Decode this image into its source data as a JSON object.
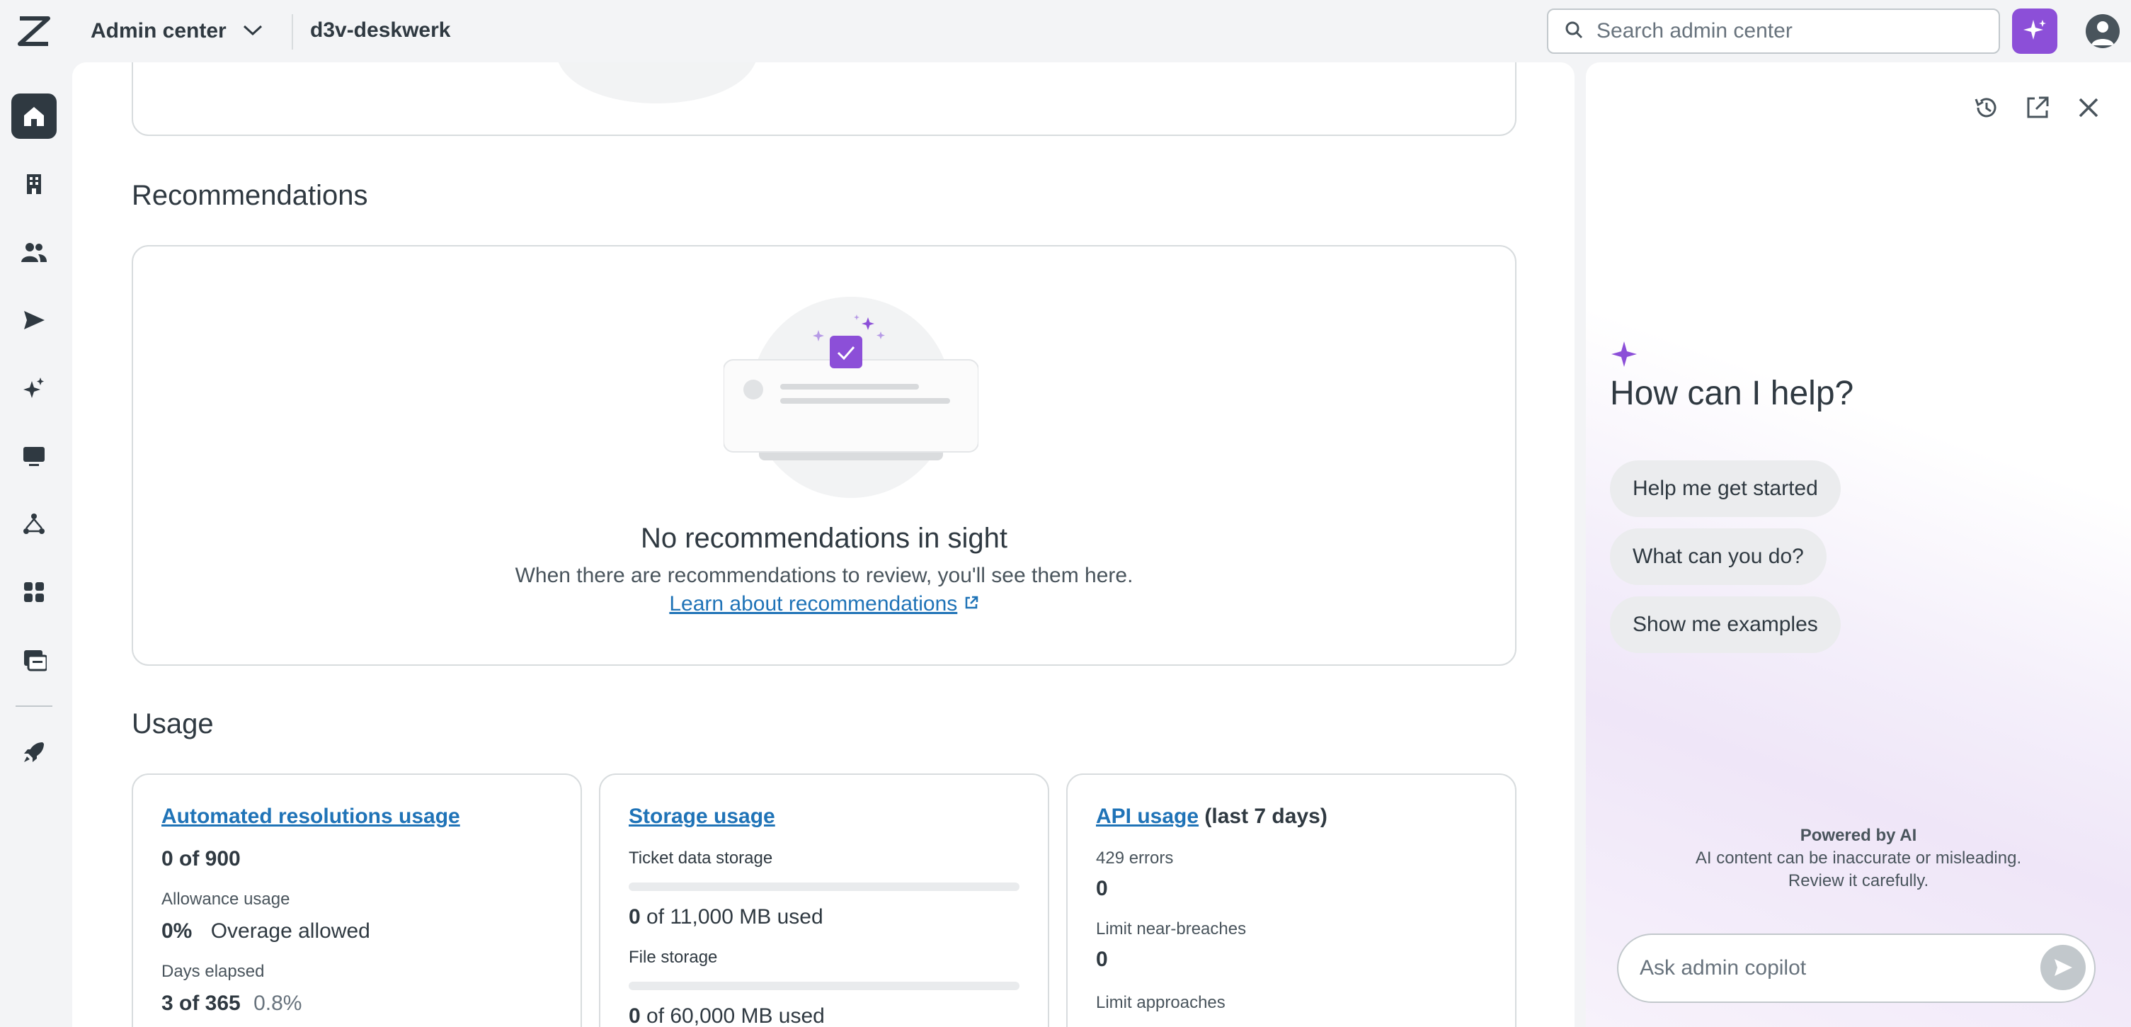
{
  "topbar": {
    "product_name": "Admin center",
    "account_name": "d3v-deskwerk",
    "search_placeholder": "Search admin center"
  },
  "sidebar": {
    "items": [
      {
        "name": "home",
        "active": true
      },
      {
        "name": "account"
      },
      {
        "name": "people"
      },
      {
        "name": "channels"
      },
      {
        "name": "ai"
      },
      {
        "name": "workspaces"
      },
      {
        "name": "objects-and-rules"
      },
      {
        "name": "apps-and-integrations"
      },
      {
        "name": "marketplace"
      },
      {
        "name": "get-started"
      }
    ]
  },
  "main": {
    "recommendations": {
      "heading": "Recommendations",
      "empty_title": "No recommendations in sight",
      "empty_description": "When there are recommendations to review, you'll see them here.",
      "learn_link": "Learn about recommendations"
    },
    "usage": {
      "heading": "Usage",
      "automated": {
        "title": "Automated resolutions usage",
        "value_num": "0",
        "value_rest": " of 900",
        "allowance_label": "Allowance usage",
        "allowance_value": "0%",
        "overage": "Overage allowed",
        "days_label": "Days elapsed",
        "days_value": "3 of 365",
        "days_percent": "0.8%"
      },
      "storage": {
        "title": "Storage usage",
        "ticket_label": "Ticket data storage",
        "ticket_used_num": "0",
        "ticket_used_rest": " of 11,000 MB used",
        "ticket_fraction": 0,
        "file_label": "File storage",
        "file_used_num": "0",
        "file_used_rest": " of 60,000 MB used",
        "file_fraction": 0
      },
      "api": {
        "title": "API usage",
        "suffix": " (last 7 days)",
        "errors_label": "429 errors",
        "errors_value": "0",
        "near_breaches_label": "Limit near-breaches",
        "near_breaches_value": "0",
        "approaches_label": "Limit approaches"
      }
    }
  },
  "copilot": {
    "heading": "How can I help?",
    "chips": [
      "Help me get started",
      "What can you do?",
      "Show me examples"
    ],
    "powered_by": "Powered by AI",
    "disclaimer_line1": "AI content can be inaccurate or misleading.",
    "disclaimer_line2": "Review it carefully.",
    "input_placeholder": "Ask admin copilot"
  },
  "colors": {
    "accent_purple": "#8c4fd8",
    "link_blue": "#1f73b7",
    "sidebar_active": "#2f3941"
  }
}
